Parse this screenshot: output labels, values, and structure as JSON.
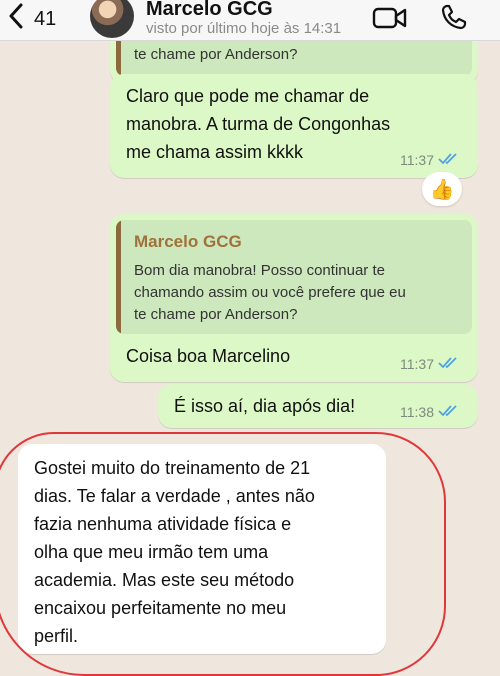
{
  "header": {
    "back_count": "41",
    "contact_name": "Marcelo GCG",
    "status": "visto por último hoje às 14:31",
    "icons": [
      "chevron-left-icon",
      "video-camera-icon",
      "phone-icon"
    ]
  },
  "messages": {
    "top_quote_fragment": "te chame por Anderson?",
    "msg1": {
      "lines": [
        "Claro que pode me chamar de",
        "manobra. A turma de Congonhas",
        "me chama assim kkkk"
      ],
      "time": "11:37"
    },
    "reaction": "👍",
    "msg2": {
      "quote_name": "Marcelo GCG",
      "quote_lines": [
        "Bom dia manobra! Posso continuar te",
        "chamando assim ou você prefere que eu",
        "te chame por Anderson?"
      ],
      "text": "Coisa boa Marcelino",
      "time": "11:37"
    },
    "msg3": {
      "text": "É isso aí, dia após dia!",
      "time": "11:38"
    },
    "msg4": {
      "lines": [
        "Gostei muito do treinamento de 21",
        "dias. Te falar a verdade , antes não",
        "fazia nenhuma atividade física  e",
        "olha que meu irmão tem uma",
        "academia. Mas este seu método",
        "encaixou perfeitamente no meu",
        "perfil."
      ]
    }
  },
  "colors": {
    "outgoing_bubble": "#dcf8c6",
    "incoming_bubble": "#ffffff",
    "quote_accent": "#a0713b",
    "read_ticks": "#4fa3e0",
    "annotation_outline": "#e0383a"
  }
}
